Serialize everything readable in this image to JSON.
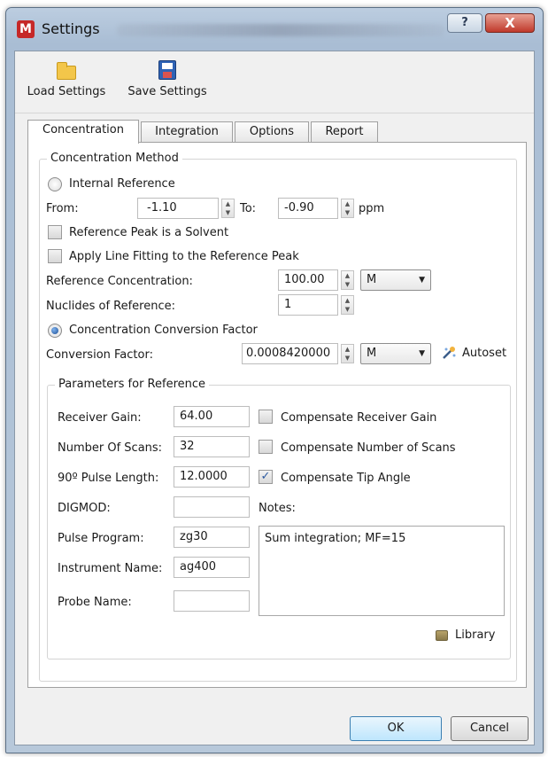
{
  "window": {
    "title": "Settings",
    "app_icon_letter": "M",
    "help_symbol": "?",
    "close_symbol": "X"
  },
  "toolbar": {
    "load_label": "Load Settings",
    "save_label": "Save Settings"
  },
  "tabs": [
    "Concentration",
    "Integration",
    "Options",
    "Report"
  ],
  "method": {
    "group_title": "Concentration Method",
    "internal_reference": {
      "label": "Internal Reference",
      "selected": false,
      "from_label": "From:",
      "from_value": "-1.10",
      "to_label": "To:",
      "to_value": "-0.90",
      "unit": "ppm"
    },
    "solvent_checkbox": {
      "label": "Reference Peak is a Solvent",
      "checked": false
    },
    "line_fitting_checkbox": {
      "label": "Apply Line Fitting to the Reference Peak",
      "checked": false
    },
    "reference_concentration": {
      "label": "Reference Concentration:",
      "value": "100.00",
      "unit": "M"
    },
    "nuclides": {
      "label": "Nuclides of Reference:",
      "value": "1"
    },
    "conversion": {
      "label": "Concentration Conversion Factor",
      "selected": true,
      "factor_label": "Conversion Factor:",
      "factor_value": "0.0008420000",
      "unit": "M",
      "autoset_label": "Autoset"
    }
  },
  "params": {
    "group_title": "Parameters for Reference",
    "receiver_gain": {
      "label": "Receiver Gain:",
      "value": "64.00"
    },
    "number_of_scans": {
      "label": "Number Of Scans:",
      "value": "32"
    },
    "pulse_length": {
      "label": "90º Pulse Length:",
      "value": "12.0000"
    },
    "digmod": {
      "label": "DIGMOD:",
      "value": ""
    },
    "pulse_program": {
      "label": "Pulse Program:",
      "value": "zg30"
    },
    "instrument_name": {
      "label": "Instrument Name:",
      "value": "ag400"
    },
    "probe_name": {
      "label": "Probe Name:",
      "value": ""
    },
    "compensate_gain": {
      "label": "Compensate Receiver Gain",
      "checked": false
    },
    "compensate_scans": {
      "label": "Compensate Number of Scans",
      "checked": false
    },
    "compensate_tip": {
      "label": "Compensate Tip Angle",
      "checked": true
    },
    "notes_label": "Notes:",
    "notes_text": "Sum integration; MF=15",
    "library_label": "Library"
  },
  "buttons": {
    "ok": "OK",
    "cancel": "Cancel"
  },
  "check_glyph": "✓",
  "spin_up": "▲",
  "spin_down": "▼",
  "combo_arrow": "▼"
}
